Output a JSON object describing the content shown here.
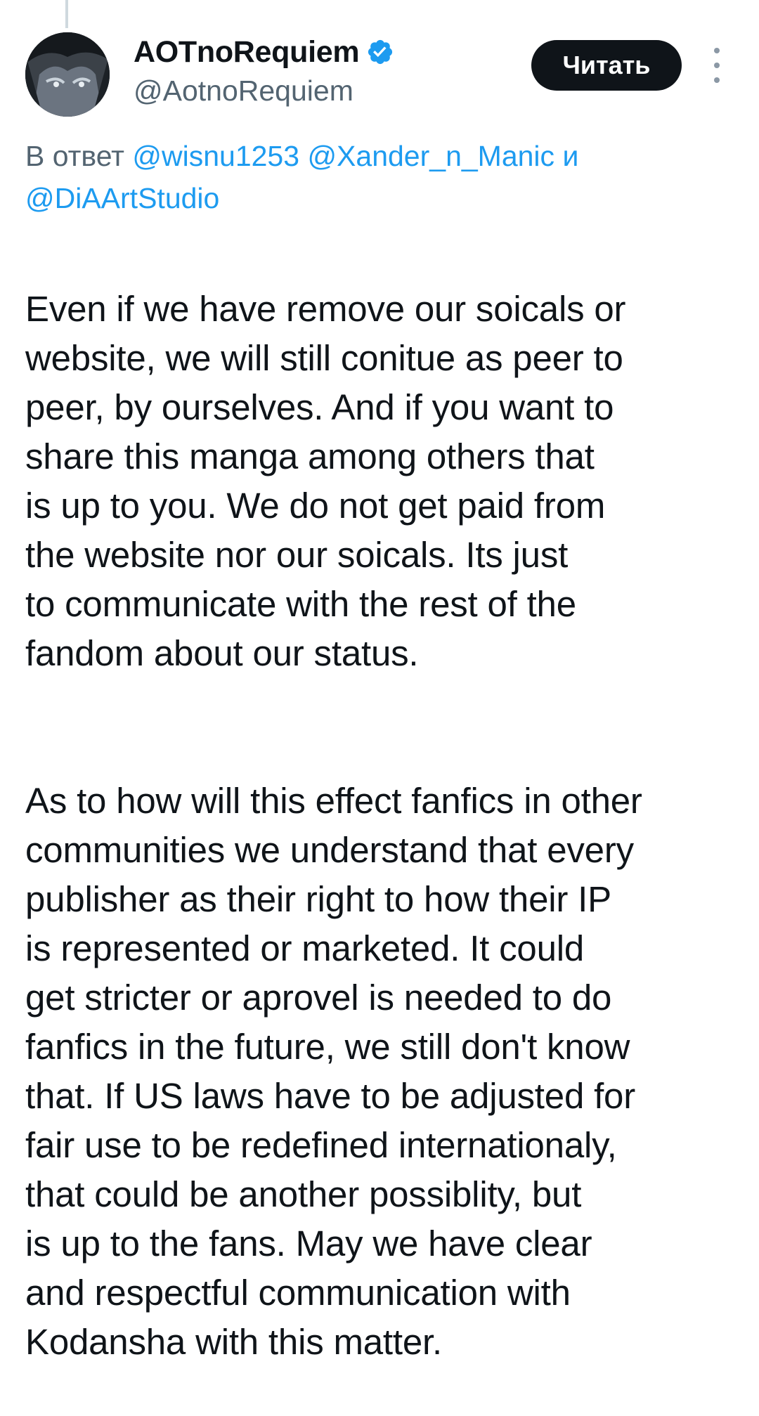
{
  "tweet": {
    "author": {
      "display_name": "AOTnoRequiem",
      "handle": "@AotnoRequiem",
      "verified": true
    },
    "follow_label": "Читать",
    "more_icon": "more-vertical-icon",
    "reply_to": {
      "prefix": "В ответ",
      "mentions": [
        "@wisnu1253",
        "@Xander_n_Manic",
        "@DiAArtStudio"
      ],
      "conjunction": "и"
    },
    "body": [
      "Even if we have remove our soicals or\nwebsite, we will still conitue as peer to\npeer, by ourselves. And if you want to\nshare this manga among others that\nis up to you. We do not get paid from\nthe website nor our soicals. Its just\nto communicate with the rest of the\nfandom about our status.",
      "As to how will this effect fanfics in other\ncommunities we understand that every\npublisher as their right to how their IP\nis represented or marketed. It could\nget stricter or aprovel is needed to do\nfanfics in the future, we still don't know\nthat. If US laws have to be adjusted for\nfair use to be redefined internationaly,\nthat could be another possiblity, but\nis up to the fans. May we have clear\nand respectful communication with\nKodansha with this matter."
    ]
  },
  "colors": {
    "text": "#0f1419",
    "secondary": "#536471",
    "link": "#1d9bf0",
    "button_bg": "#0f1419",
    "button_text": "#ffffff",
    "verified": "#1d9bf0"
  }
}
